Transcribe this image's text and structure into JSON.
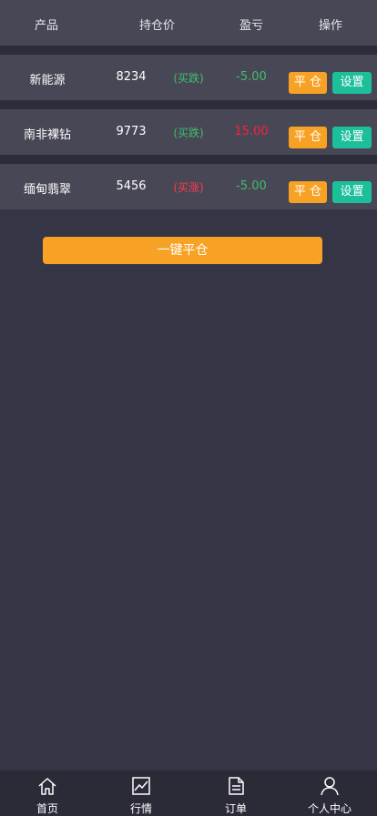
{
  "header": {
    "product": "产品",
    "price": "持仓价",
    "pnl": "盈亏",
    "action": "操作"
  },
  "positions": [
    {
      "name": "新能源",
      "price": "8234",
      "direction": "(买跌)",
      "direction_color": "#3fbf6b",
      "pnl": "-5.00",
      "pnl_color": "#3fbf6b",
      "close_label": "平 仓",
      "settings_label": "设置"
    },
    {
      "name": "南非裸钻",
      "price": "9773",
      "direction": "(买跌)",
      "direction_color": "#3fbf6b",
      "pnl": "15.00",
      "pnl_color": "#ff1f3a",
      "close_label": "平 仓",
      "settings_label": "设置"
    },
    {
      "name": "缅甸翡翠",
      "price": "5456",
      "direction": "(买涨)",
      "direction_color": "#ff3b4a",
      "pnl": "-5.00",
      "pnl_color": "#3fbf6b",
      "close_label": "平 仓",
      "settings_label": "设置"
    }
  ],
  "close_all_label": "一键平仓",
  "tabbar": {
    "home": "首页",
    "market": "行情",
    "orders": "订单",
    "profile": "个人中心"
  },
  "colors": {
    "accent_orange": "#f7a225",
    "accent_teal": "#1dbf9b",
    "loss_green": "#3fbf6b",
    "gain_red": "#ff1f3a"
  }
}
